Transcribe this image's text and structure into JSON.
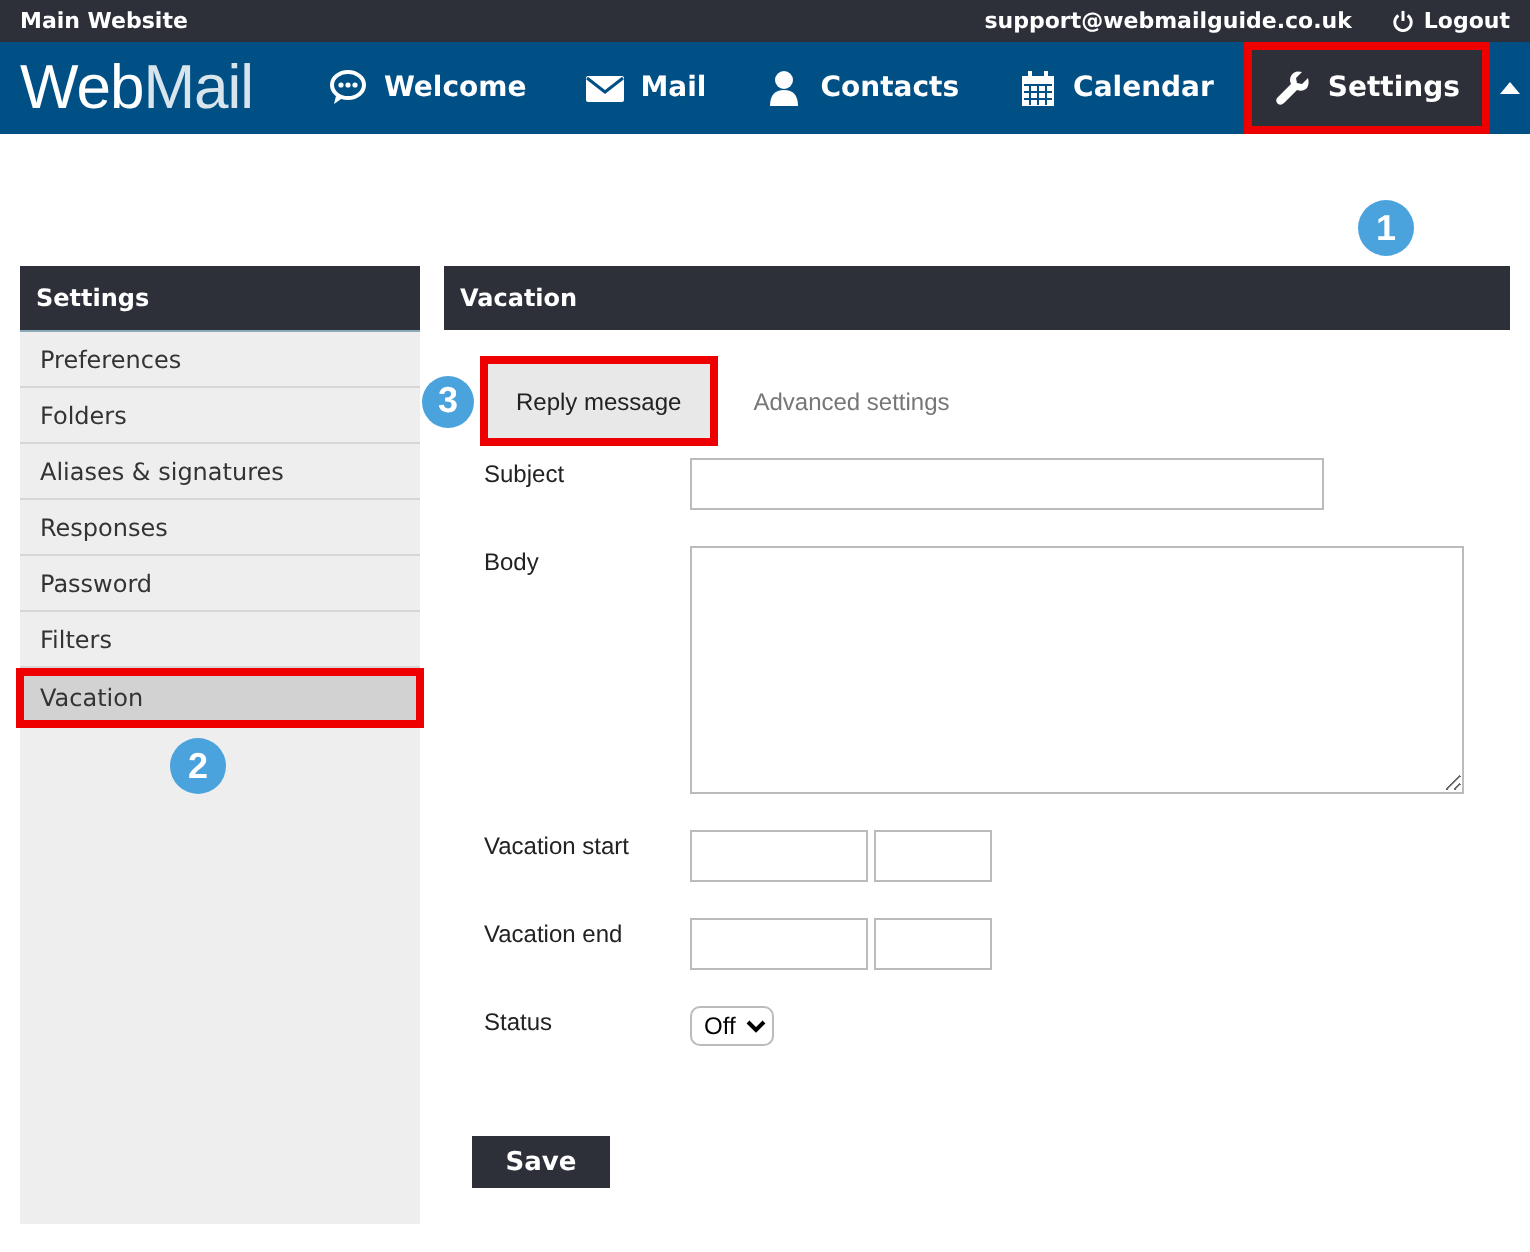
{
  "top_bar": {
    "site_link": "Main Website",
    "email": "support@webmailguide.co.uk",
    "logout": "Logout"
  },
  "header": {
    "logo_left": "Web",
    "logo_right": "Mail",
    "nav": [
      {
        "kind": "chat",
        "label": "Welcome",
        "selected": false,
        "highlighted": false
      },
      {
        "kind": "mail",
        "label": "Mail",
        "selected": false,
        "highlighted": false
      },
      {
        "kind": "person",
        "label": "Contacts",
        "selected": false,
        "highlighted": false
      },
      {
        "kind": "calendar",
        "label": "Calendar",
        "selected": false,
        "highlighted": false
      },
      {
        "kind": "wrench",
        "label": "Settings",
        "selected": true,
        "highlighted": true,
        "callout": "1"
      }
    ]
  },
  "sidebar": {
    "title": "Settings",
    "items": [
      {
        "label": "Preferences",
        "selected": false,
        "highlighted": false
      },
      {
        "label": "Folders",
        "selected": false,
        "highlighted": false
      },
      {
        "label": "Aliases & signatures",
        "selected": false,
        "highlighted": false
      },
      {
        "label": "Responses",
        "selected": false,
        "highlighted": false
      },
      {
        "label": "Password",
        "selected": false,
        "highlighted": false
      },
      {
        "label": "Filters",
        "selected": false,
        "highlighted": false
      },
      {
        "label": "Vacation",
        "selected": true,
        "highlighted": true,
        "callout": "2"
      }
    ]
  },
  "panel": {
    "title": "Vacation",
    "tabs": [
      {
        "label": "Reply message",
        "selected": true,
        "highlighted": true,
        "callout": "3"
      },
      {
        "label": "Advanced settings",
        "selected": false,
        "highlighted": false
      }
    ],
    "fields": [
      {
        "kind": "text",
        "label": "Subject"
      },
      {
        "kind": "textarea",
        "label": "Body"
      },
      {
        "kind": "datetime",
        "label": "Vacation start"
      },
      {
        "kind": "datetime",
        "label": "Vacation end"
      },
      {
        "kind": "select",
        "label": "Status",
        "value": "Off"
      }
    ],
    "save": "Save"
  }
}
